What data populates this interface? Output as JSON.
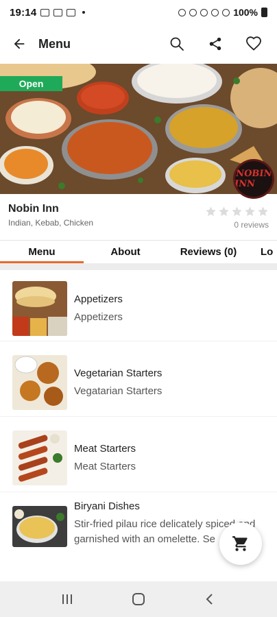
{
  "status_bar": {
    "time": "19:14",
    "battery": "100%"
  },
  "app_bar": {
    "title": "Menu"
  },
  "hero": {
    "open_label": "Open",
    "logo_text": "NOBIN INN"
  },
  "restaurant": {
    "name": "Nobin Inn",
    "cuisine": "Indian, Kebab, Chicken",
    "rating_stars": 0,
    "reviews_text": "0 reviews"
  },
  "tabs": [
    {
      "label": "Menu",
      "active": true
    },
    {
      "label": "About",
      "active": false
    },
    {
      "label": "Reviews (0)",
      "active": false
    },
    {
      "label": "Lo",
      "active": false
    }
  ],
  "menu_items": [
    {
      "name": "Appetizers",
      "description": "Appetizers"
    },
    {
      "name": "Vegetarian Starters",
      "description": "Vegatarian Starters"
    },
    {
      "name": "Meat Starters",
      "description": "Meat Starters"
    },
    {
      "name": "Biryani Dishes",
      "description": "Stir-fried pilau rice delicately spiced and",
      "description_line2": "garnished with an omelette. Se"
    }
  ],
  "colors": {
    "accent": "#e9692c",
    "open_badge": "#1faa59"
  },
  "icons": [
    "back-arrow-icon",
    "search-icon",
    "share-icon",
    "heart-icon",
    "star-icon",
    "cart-icon",
    "recents-icon",
    "home-icon",
    "back-nav-icon"
  ]
}
